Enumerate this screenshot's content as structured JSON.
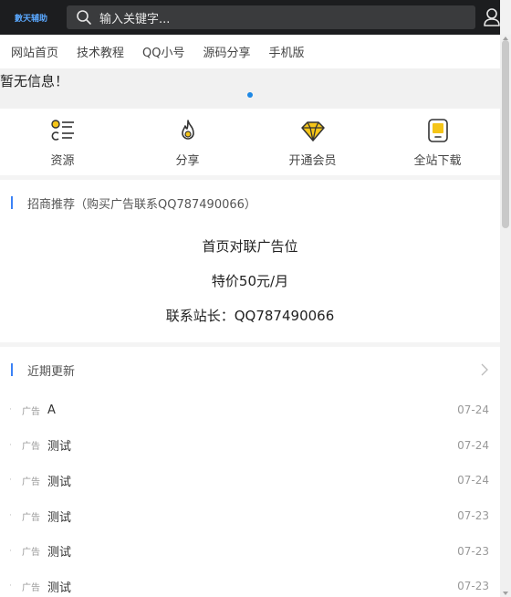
{
  "header": {
    "logo": "數天辅助",
    "search_placeholder": "输入关键字..."
  },
  "nav": [
    "网站首页",
    "技术教程",
    "QQ小号",
    "源码分享",
    "手机版"
  ],
  "notice": {
    "text": "暂无信息！"
  },
  "quick_links": [
    {
      "label": "资源",
      "icon": "resource-list-icon"
    },
    {
      "label": "分享",
      "icon": "flame-icon"
    },
    {
      "label": "开通会员",
      "icon": "diamond-icon"
    },
    {
      "label": "全站下载",
      "icon": "download-card-icon"
    }
  ],
  "ad_section": {
    "title": "招商推荐（购买广告联系QQ787490066）",
    "lines": [
      "首页对联广告位",
      "特价50元/月",
      "联系站长：QQ787490066"
    ]
  },
  "recent": {
    "title": "近期更新",
    "items": [
      {
        "tag": "广告",
        "title": "A",
        "date": "07-24"
      },
      {
        "tag": "广告",
        "title": "测试",
        "date": "07-24"
      },
      {
        "tag": "广告",
        "title": "测试",
        "date": "07-24"
      },
      {
        "tag": "广告",
        "title": "测试",
        "date": "07-23"
      },
      {
        "tag": "广告",
        "title": "测试",
        "date": "07-23"
      },
      {
        "tag": "广告",
        "title": "测试",
        "date": "07-23"
      }
    ]
  },
  "colors": {
    "accent": "#1e88e5",
    "header_bg": "#1c1d1f",
    "icon_yellow": "#f5c518"
  }
}
